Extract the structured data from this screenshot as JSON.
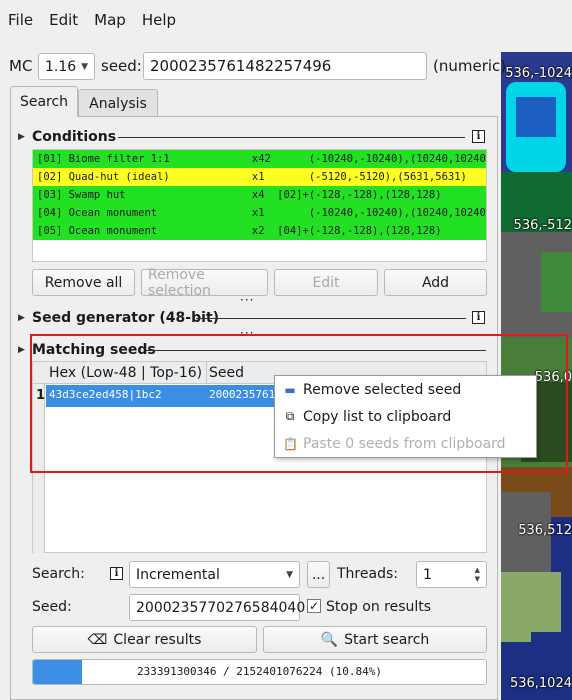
{
  "menubar": [
    "File",
    "Edit",
    "Map",
    "Help"
  ],
  "mc": {
    "label": "MC",
    "version": "1.16"
  },
  "seed": {
    "label": "seed:",
    "value": "2000235761482257496",
    "suffix": "(numeric)"
  },
  "tabs": [
    "Search",
    "Analysis"
  ],
  "conditions": {
    "title": "Conditions",
    "rows": [
      {
        "text": "[01] Biome filter 1:1             x42      (-10240,-10240),(10240,10240)",
        "color": "#22e022"
      },
      {
        "text": "[02] Quad-hut (ideal)             x1       (-5120,-5120),(5631,5631)",
        "color": "#ffff22"
      },
      {
        "text": "[03] Swamp hut                    x4  [02]+(-128,-128),(128,128)",
        "color": "#22e022"
      },
      {
        "text": "[04] Ocean monument               x1       (-10240,-10240),(10240,10240)",
        "color": "#22e022"
      },
      {
        "text": "[05] Ocean monument               x2  [04]+(-128,-128),(128,128)",
        "color": "#22e022"
      }
    ],
    "buttons": {
      "remove_all": "Remove all",
      "remove_selection": "Remove selection",
      "edit": "Edit",
      "add": "Add"
    }
  },
  "seed_generator": {
    "title": "Seed generator (48-bit)"
  },
  "matching": {
    "title": "Matching seeds",
    "headers": [
      "Hex (Low-48 | Top-16)",
      "Seed"
    ],
    "rows": [
      {
        "num": "1",
        "hex": "43d3ce2ed458|1bc2",
        "seed": "200023576148"
      }
    ]
  },
  "context_menu": [
    {
      "label": "Remove selected seed",
      "icon": "minus-icon",
      "enabled": true
    },
    {
      "label": "Copy list to clipboard",
      "icon": "copy-icon",
      "enabled": true
    },
    {
      "label": "Paste 0 seeds from clipboard",
      "icon": "paste-icon",
      "enabled": false
    }
  ],
  "search": {
    "search_label": "Search:",
    "mode": "Incremental",
    "more": "...",
    "threads_label": "Threads:",
    "threads": "1",
    "seed_label": "Seed:",
    "seed_value": "2000235770276584040",
    "stop_label": "Stop on results",
    "clear": "Clear results",
    "start": "Start search"
  },
  "progress": {
    "text": "233391300346 / 2152401076224 (10.84%)",
    "fraction": 0.1084
  },
  "map_labels": [
    "536,-1024",
    "536,-512",
    "536,0",
    "536,512",
    "536,1024"
  ],
  "colors": {
    "selection": "#3a8ee6",
    "highlight_box": "#e01a1a",
    "ocean": "#1c2f84"
  }
}
